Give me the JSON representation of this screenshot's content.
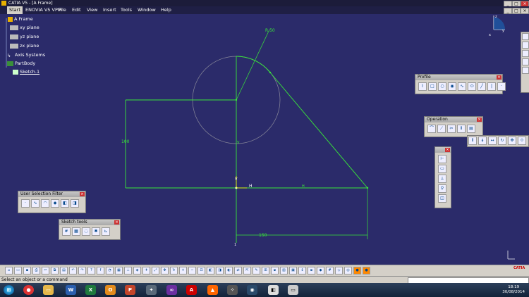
{
  "window": {
    "title": "CATIA V5 - [A Frame]"
  },
  "menu": {
    "items": [
      "Start",
      "ENOVIA V5 VPM",
      "File",
      "Edit",
      "View",
      "Insert",
      "Tools",
      "Window",
      "Help"
    ]
  },
  "tree": {
    "root": "A Frame",
    "items": [
      "xy plane",
      "yz plane",
      "zx plane",
      "Axis Systems",
      "PartBody",
      "Sketch.1"
    ]
  },
  "sketch": {
    "radius_label": "R 50",
    "height_label": "100",
    "width_label": "150",
    "h_label": "H",
    "v_label": "V",
    "axis_h": "H",
    "axis_v": "V",
    "origin_label": "1"
  },
  "compass": {
    "x_label": "x",
    "y_label": "y",
    "z_label": "z"
  },
  "toolbars": {
    "profile": {
      "title": "Profile"
    },
    "operation": {
      "title": "Operation"
    },
    "user_selection_filter": {
      "title": "User Selection Filter"
    },
    "sketch_tools": {
      "title": "Sketch tools"
    }
  },
  "status": {
    "message": "Select an object or a command"
  },
  "taskbar": {
    "time": "18:19",
    "date": "30/08/2014"
  },
  "colors": {
    "background": "#2b2b6a",
    "geometry": "#39e639",
    "construction": "#8a8a9a",
    "toolbar": "#d4d0c8"
  },
  "brand": {
    "logo_text": "CATIA"
  }
}
